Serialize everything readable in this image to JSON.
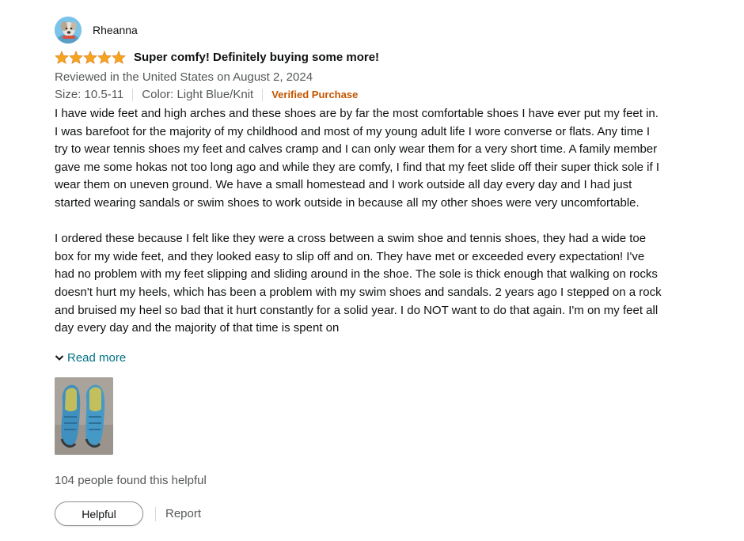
{
  "reviewer": {
    "name": "Rheanna",
    "avatar_icon": "dog-avatar-icon"
  },
  "rating": {
    "stars": 5,
    "max": 5,
    "star_color": "#f4a41d"
  },
  "title": "Super comfy! Definitely buying some more!",
  "date_line": "Reviewed in the United States on August 2, 2024",
  "format": {
    "size": "Size: 10.5-11",
    "color": "Color: Light Blue/Knit",
    "verified": "Verified Purchase"
  },
  "body": {
    "paragraph_1": "I have wide feet and high arches and these shoes are by far the most comfortable shoes I have ever put my feet in. I was barefoot for the majority of my childhood and most of my young adult life I wore converse or flats. Any time I try to wear tennis shoes my feet and calves cramp and I can only wear them for a very short time. A family member gave me some hokas not too long ago and while they are comfy, I find that my feet slide off their super thick sole if I wear them on uneven ground. We have a small homestead and I work outside all day every day and I had just started wearing sandals or swim shoes to work outside in because all my other shoes were very uncomfortable.",
    "paragraph_2": "I ordered these because I felt like they were a cross between a swim shoe and tennis shoes, they had a wide toe box for my wide feet, and they looked easy to slip off and on. They have met or exceeded every expectation! I've had no problem with my feet slipping and sliding around in the shoe. The sole is thick enough that walking on rocks doesn't hurt my heels, which has been a problem with my swim shoes and sandals. 2 years ago I stepped on a rock and bruised my heel so bad that it hurt constantly for a solid year. I do NOT want to do that again. I'm on my feet all day every day and the majority of that time is spent on"
  },
  "read_more": "Read more",
  "read_more_icon": "chevron-down-icon",
  "image": {
    "icon": "shoes-photo-thumbnail"
  },
  "helpful_count": "104 people found this helpful",
  "actions": {
    "helpful_label": "Helpful",
    "report_label": "Report"
  },
  "colors": {
    "link": "#007185",
    "verified": "#c45500",
    "muted": "#565959",
    "text": "#0f1111"
  }
}
